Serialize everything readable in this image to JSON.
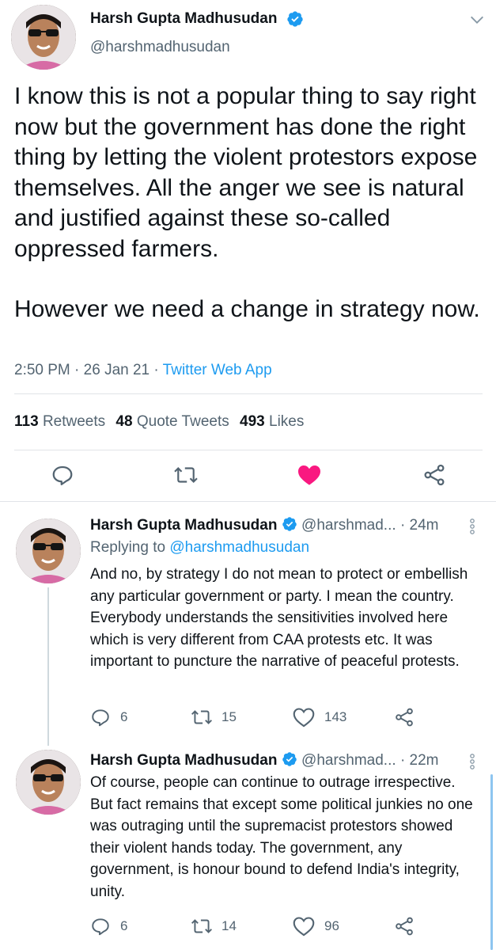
{
  "main_tweet": {
    "author_name": "Harsh Gupta Madhusudan",
    "author_handle": "@harshmadhusudan",
    "text_paragraphs": [
      "I know this is not a popular thing to say right now but the government has done the right thing by letting the violent protestors expose themselves. All the anger we see is natural and justified against these so-called oppressed farmers.",
      "However we need a change in strategy now."
    ],
    "time": "2:50 PM",
    "date": "26 Jan 21",
    "source": "Twitter Web App",
    "sep": "·",
    "retweets_count": "113",
    "retweets_label": "Retweets",
    "quotes_count": "48",
    "quotes_label": "Quote Tweets",
    "likes_count": "493",
    "likes_label": "Likes"
  },
  "replies": [
    {
      "author_name": "Harsh Gupta Madhusudan",
      "author_handle": "@harshmad...",
      "time_ago": "· 24m",
      "replying_prefix": "Replying to",
      "replying_to": "@harshmadhusudan",
      "text": "And no, by strategy I do not mean to protect or embellish any particular government or party. I mean the country. Everybody understands the sensitivities involved here which is very different from CAA protests etc. It was important to puncture the narrative of peaceful protests.",
      "reply_count": "6",
      "retweet_count": "15",
      "like_count": "143"
    },
    {
      "author_name": "Harsh Gupta Madhusudan",
      "author_handle": "@harshmad...",
      "time_ago": "· 22m",
      "text": "Of course, people can continue to outrage irrespective. But fact remains that except some political junkies no one was outraging until the supremacist protestors showed their violent hands today. The government, any government, is honour bound to defend India's integrity, unity.",
      "reply_count": "6",
      "retweet_count": "14",
      "like_count": "96"
    }
  ],
  "icons": {
    "verified": "verified-badge-icon",
    "more": "chevron-down-icon",
    "reply": "reply-icon",
    "retweet": "retweet-icon",
    "like": "heart-icon",
    "share": "share-icon",
    "menu": "vertical-dots-icon"
  },
  "colors": {
    "accent": "#1d9bf0",
    "like_active": "#f91880",
    "muted": "#536471"
  }
}
